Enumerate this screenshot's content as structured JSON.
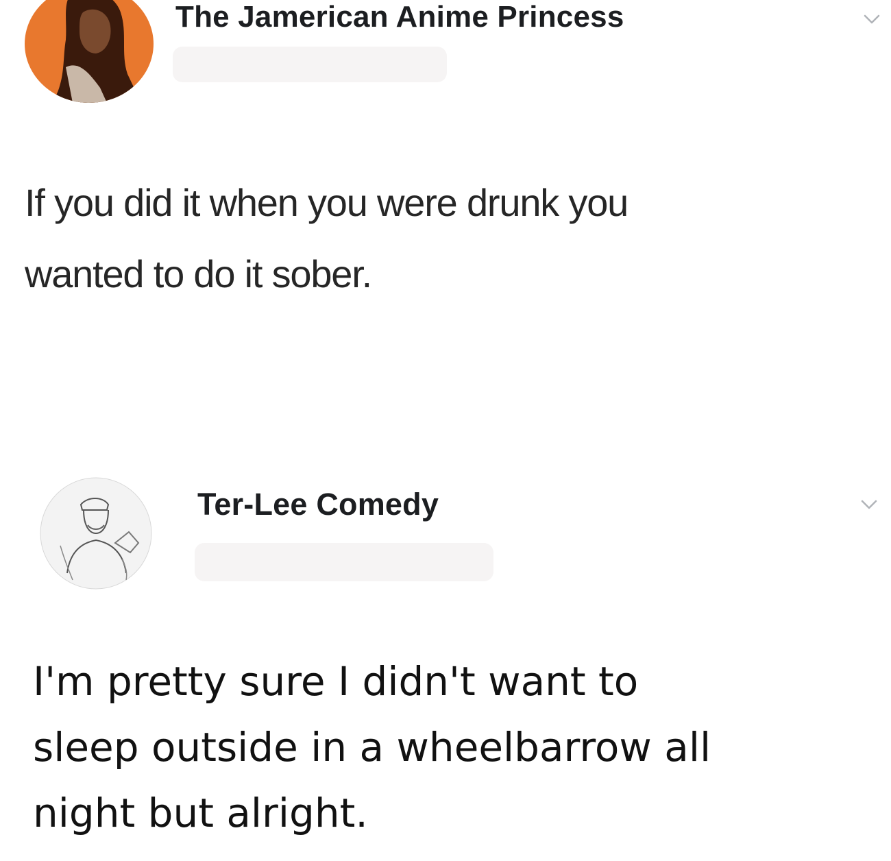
{
  "posts": [
    {
      "author": "The Jamerican Anime Princess",
      "avatar_icon": "profile-photo-avatar",
      "menu_icon": "chevron-down-icon",
      "text": "If you did it when you were drunk you\nwanted to do it sober."
    },
    {
      "author": "Ter-Lee Comedy",
      "avatar_icon": "sketch-profile-avatar",
      "menu_icon": "chevron-down-icon",
      "text": "I'm pretty sure I didn't want to\nsleep outside in a wheelbarrow all\nnight but alright."
    }
  ],
  "colors": {
    "avatar_1_background": "#e8782e",
    "text": "#1c1e21",
    "chevron": "#b0b3b8",
    "redaction": "#f6f4f4"
  }
}
